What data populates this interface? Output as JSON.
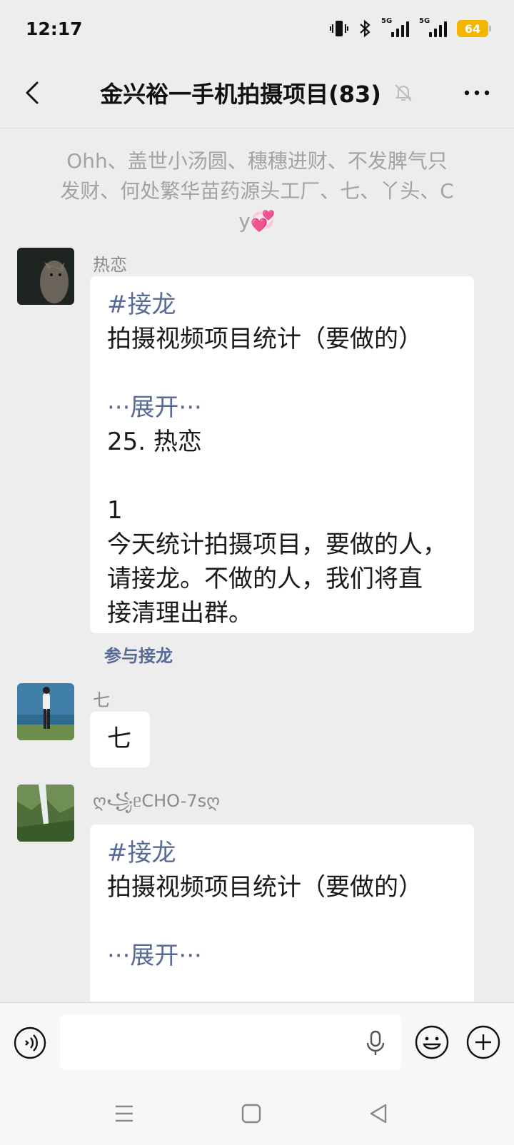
{
  "status_bar": {
    "time": "12:17",
    "network_1": "5G",
    "network_2": "5G",
    "battery": "64",
    "battery_color": "#f3b600",
    "icons": [
      "vibrate-icon",
      "bluetooth-icon",
      "signal-icon",
      "signal-icon",
      "battery-icon"
    ]
  },
  "header": {
    "title": "金兴裕一手机拍摄项目(83)",
    "icons": [
      "back-arrow-icon",
      "mute-bell-icon",
      "more-dots-icon"
    ]
  },
  "system_message": {
    "text": "Ohh、盖世小汤圆、穗穗进财、不发脾气只发财、何处繁华苗药源头工厂、七、丫头、C y💞"
  },
  "messages": [
    {
      "sender": "热恋",
      "lines": [
        {
          "text": "#接龙",
          "accent": true
        },
        {
          "text": "拍摄视频项目统计（要做的）",
          "accent": false
        },
        {
          "text": " ",
          "accent": false
        },
        {
          "text": "···展开···",
          "accent": true
        },
        {
          "text": "25. 热恋",
          "accent": false
        },
        {
          "text": " ",
          "accent": false
        },
        {
          "text": "1",
          "accent": false
        },
        {
          "text": "今天统计拍摄项目，要做的人，",
          "accent": false
        },
        {
          "text": "请接龙。不做的人，我们将直",
          "accent": false
        },
        {
          "text": "接清理出群。",
          "accent": false
        }
      ],
      "action": "参与接龙"
    },
    {
      "sender": "七",
      "lines": [
        {
          "text": "七",
          "accent": false
        }
      ]
    },
    {
      "sender": "ღ꧁ᥱCHO-7sღ",
      "lines": [
        {
          "text": "#接龙",
          "accent": true
        },
        {
          "text": "拍摄视频项目统计（要做的）",
          "accent": false
        },
        {
          "text": " ",
          "accent": false
        },
        {
          "text": "···展开···",
          "accent": true
        }
      ]
    }
  ],
  "input_bar": {
    "placeholder": "",
    "icons": [
      "voice-icon",
      "mic-icon",
      "emoji-icon",
      "plus-icon"
    ]
  },
  "nav_bar": {
    "icons": [
      "menu-icon",
      "home-icon",
      "back-icon"
    ]
  },
  "colors": {
    "background": "#ededed",
    "accent_link": "#576b95",
    "bubble": "#ffffff"
  }
}
